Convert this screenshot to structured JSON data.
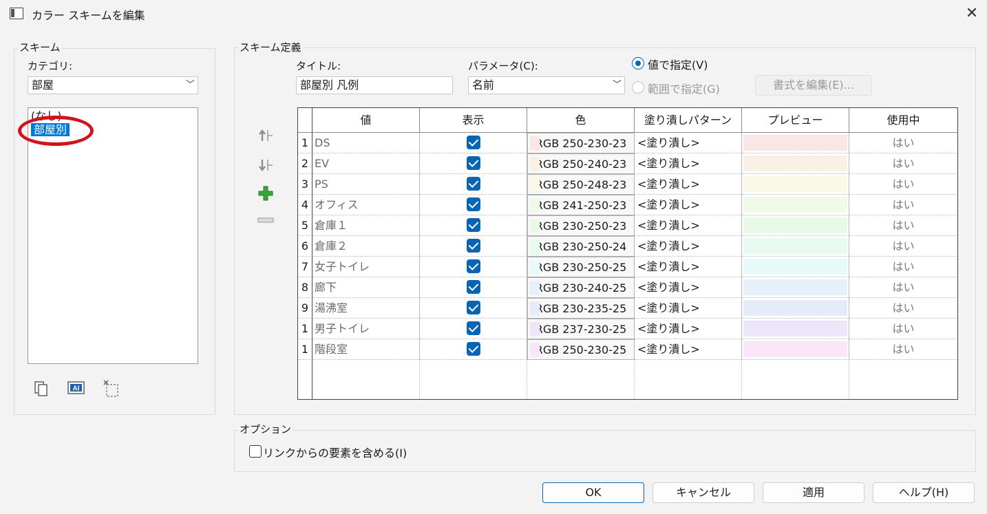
{
  "window": {
    "title": "カラー スキームを編集",
    "close_glyph": "✕"
  },
  "scheme_panel": {
    "group_label": "スキーム",
    "category_label": "カテゴリ:",
    "category_value": "部屋",
    "list_items": [
      "(なし)",
      "部屋別"
    ],
    "selected_index": 1
  },
  "definition": {
    "group_label": "スキーム定義",
    "title_label": "タイトル:",
    "title_value": "部屋別 凡例",
    "parameter_label": "パラメータ(C):",
    "parameter_value": "名前",
    "radio_by_value": "値で指定(V)",
    "radio_by_range": "範囲で指定(G)",
    "edit_format_button": "書式を編集(E)..."
  },
  "table": {
    "headers": [
      "値",
      "表示",
      "色",
      "塗り潰しパターン",
      "プレビュー",
      "使用中"
    ],
    "rows": [
      {
        "num": "1",
        "value": "DS",
        "visible": true,
        "color": "RGB 250-230-23",
        "pattern": "<塗り潰し>",
        "swatch": "#fae6e6",
        "in_use": "はい"
      },
      {
        "num": "2",
        "value": "EV",
        "visible": true,
        "color": "RGB 250-240-23",
        "pattern": "<塗り潰し>",
        "swatch": "#faf0e6",
        "in_use": "はい"
      },
      {
        "num": "3",
        "value": "PS",
        "visible": true,
        "color": "RGB 250-248-23",
        "pattern": "<塗り潰し>",
        "swatch": "#faf8e6",
        "in_use": "はい"
      },
      {
        "num": "4",
        "value": "オフィス",
        "visible": true,
        "color": "RGB 241-250-23",
        "pattern": "<塗り潰し>",
        "swatch": "#f1fae6",
        "in_use": "はい"
      },
      {
        "num": "5",
        "value": "倉庫１",
        "visible": true,
        "color": "RGB 230-250-23",
        "pattern": "<塗り潰し>",
        "swatch": "#e6fae6",
        "in_use": "はい"
      },
      {
        "num": "6",
        "value": "倉庫２",
        "visible": true,
        "color": "RGB 230-250-24",
        "pattern": "<塗り潰し>",
        "swatch": "#e6faf0",
        "in_use": "はい"
      },
      {
        "num": "7",
        "value": "女子トイレ",
        "visible": true,
        "color": "RGB 230-250-25",
        "pattern": "<塗り潰し>",
        "swatch": "#e6fafa",
        "in_use": "はい"
      },
      {
        "num": "8",
        "value": "廊下",
        "visible": true,
        "color": "RGB 230-240-25",
        "pattern": "<塗り潰し>",
        "swatch": "#e6f0fa",
        "in_use": "はい"
      },
      {
        "num": "9",
        "value": "湯沸室",
        "visible": true,
        "color": "RGB 230-235-25",
        "pattern": "<塗り潰し>",
        "swatch": "#e6ebfa",
        "in_use": "はい"
      },
      {
        "num": "1",
        "value": "男子トイレ",
        "visible": true,
        "color": "RGB 237-230-25",
        "pattern": "<塗り潰し>",
        "swatch": "#ede6fa",
        "in_use": "はい"
      },
      {
        "num": "1",
        "value": "階段室",
        "visible": true,
        "color": "RGB 250-230-25",
        "pattern": "<塗り潰し>",
        "swatch": "#fae6fa",
        "in_use": "はい"
      }
    ]
  },
  "options": {
    "group_label": "オプション",
    "include_links_label": "リンクからの要素を含める(I)",
    "include_links_checked": false
  },
  "buttons": {
    "ok": "OK",
    "cancel": "キャンセル",
    "apply": "適用",
    "help": "ヘルプ(H)"
  },
  "icons": {
    "move_up": "move-up-icon",
    "move_down": "move-down-icon",
    "add": "add-icon",
    "remove": "remove-icon",
    "duplicate": "duplicate-icon",
    "rename": "rename-icon",
    "delete": "delete-icon"
  },
  "colors": {
    "accent": "#0a64b4",
    "selection": "#0078d7",
    "annotation": "#d0141d",
    "add_green": "#3aa63a"
  }
}
